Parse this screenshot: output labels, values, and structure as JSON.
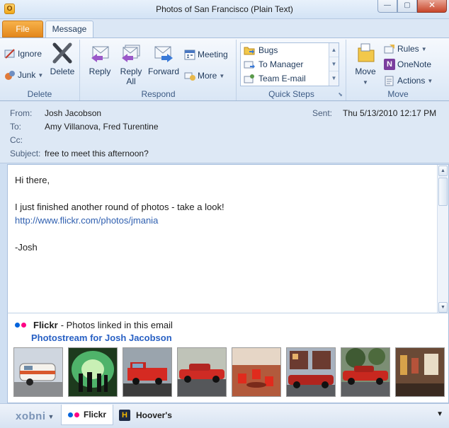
{
  "window": {
    "title": "Photos of San Francisco (Plain Text)",
    "app_icon": "O",
    "close_glyph": "✕",
    "min_glyph": "—",
    "max_glyph": "▢"
  },
  "tabs": {
    "file": "File",
    "message": "Message"
  },
  "ribbon": {
    "delete": {
      "label": "Delete",
      "ignore": "Ignore",
      "junk": "Junk",
      "delete_btn": "Delete"
    },
    "respond": {
      "label": "Respond",
      "reply": "Reply",
      "reply_all_1": "Reply",
      "reply_all_2": "All",
      "forward": "Forward",
      "meeting": "Meeting",
      "more": "More"
    },
    "quick_steps": {
      "label": "Quick Steps",
      "items": [
        "Bugs",
        "To Manager",
        "Team E-mail"
      ]
    },
    "move": {
      "label": "Move",
      "move_btn": "Move",
      "rules": "Rules",
      "onenote": "OneNote",
      "actions": "Actions"
    }
  },
  "header": {
    "from_label": "From:",
    "from": "Josh Jacobson",
    "to_label": "To:",
    "to": "Amy Villanova, Fred Turentine",
    "cc_label": "Cc:",
    "cc": "",
    "subject_label": "Subject:",
    "subject": "free to meet this afternoon?",
    "sent_label": "Sent:",
    "sent": "Thu 5/13/2010 12:17 PM"
  },
  "body": {
    "greeting": "Hi there,",
    "line1": "I just finished another round of photos - take a look!",
    "link": "http://www.flickr.com/photos/jmania",
    "signature": "-Josh"
  },
  "social_pane": {
    "source": "Flickr",
    "source_suffix": "- Photos linked in this email",
    "photostream": "Photostream for Josh Jacobson",
    "photo_count": 8
  },
  "bottom_bar": {
    "brand": "xobni",
    "tab_flickr": "Flickr",
    "tab_hoovers": "Hoover's",
    "hoovers_icon": "H"
  },
  "colors": {
    "flickr_blue": "#0063dc",
    "flickr_pink": "#ff0084",
    "link": "#3060b0"
  }
}
